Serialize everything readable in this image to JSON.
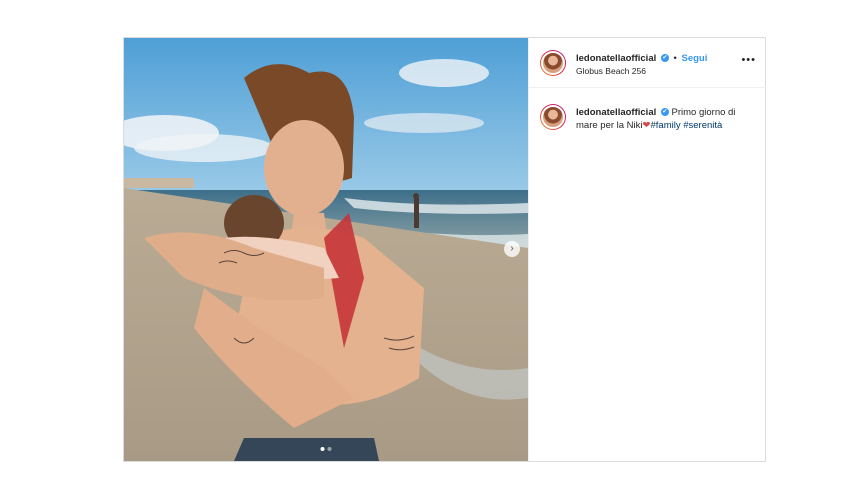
{
  "post": {
    "username": "ledonatellaofficial",
    "verified_mark": "✔",
    "separator": "•",
    "follow_label": "Segui",
    "location": "Globus Beach 256",
    "more_icon": "•••",
    "caption": {
      "username": "ledonatellaofficial",
      "text": "Primo giorno di mare per la Niki",
      "heart": "❤",
      "hashtags": [
        "#family",
        "#serenità"
      ]
    },
    "carousel": {
      "next_icon": "›",
      "slides": 2,
      "active_index": 0
    }
  },
  "colors": {
    "link": "#3897f0",
    "hashtag": "#00376b",
    "border": "#dbdbdb"
  }
}
